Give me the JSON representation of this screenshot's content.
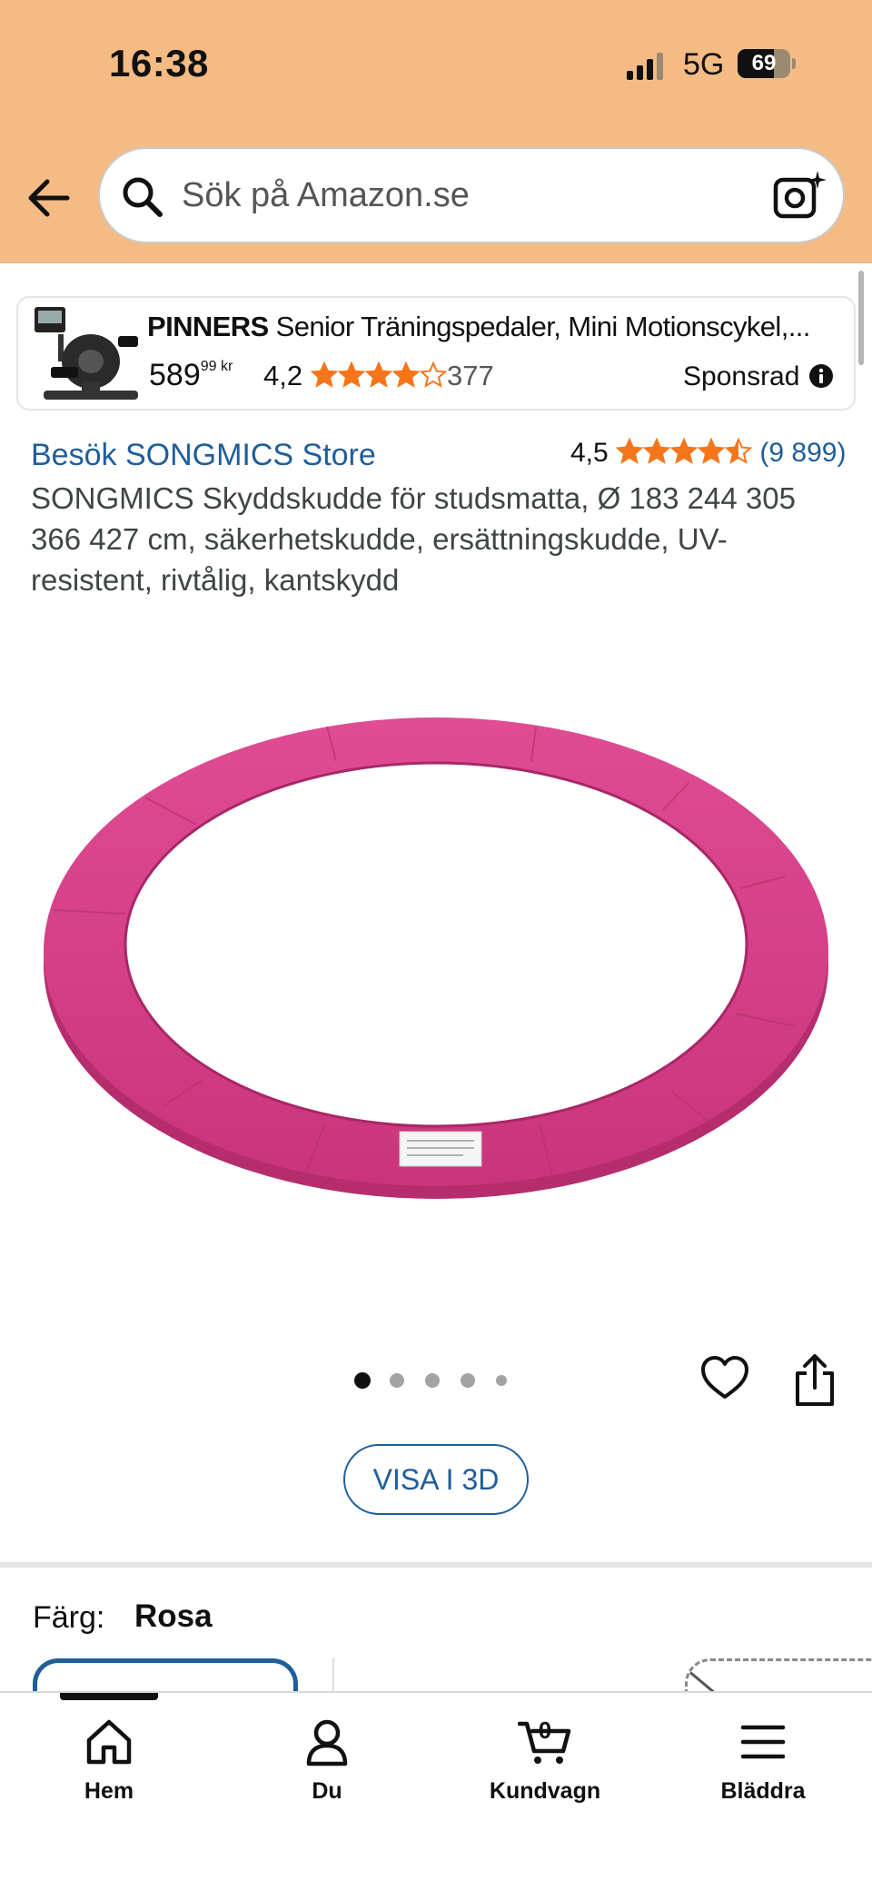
{
  "status_bar": {
    "time": "16:38",
    "network": "5G",
    "battery": "69",
    "battery_level": 0.69
  },
  "header": {
    "search_placeholder": "Sök på Amazon.se",
    "icons": [
      "back-arrow-icon",
      "search-icon",
      "camera-search-icon"
    ]
  },
  "ad": {
    "brand": "PINNERS",
    "title": "Senior Träningspedaler, Mini Motionscykel,...",
    "price_main": "589",
    "price_fraction": "99",
    "price_currency": "kr",
    "rating": "4,2",
    "rating_value": 4.2,
    "review_count": "377",
    "sponsored_label": "Sponsrad"
  },
  "product": {
    "store_link": "Besök SONGMICS Store",
    "rating": "4,5",
    "rating_value": 4.5,
    "review_count": "(9 899)",
    "title": "SONGMICS Skyddskudde för studsmatta, Ø 183 244 305 366 427 cm, säkerhetskudde, ersättningskudde, UV-resistent, rivtålig, kantskydd",
    "image_color": "#d93f8a",
    "image_count": 5,
    "active_image": 1,
    "view_3d_label": "VISA I 3D"
  },
  "variation": {
    "color_label": "Färg:",
    "color_value": "Rosa"
  },
  "bottom_nav": {
    "items": [
      {
        "label": "Hem",
        "icon": "home-icon"
      },
      {
        "label": "Du",
        "icon": "user-icon"
      },
      {
        "label": "Kundvagn",
        "icon": "cart-icon"
      },
      {
        "label": "Bläddra",
        "icon": "menu-icon"
      }
    ],
    "cart_count": "0",
    "active_index": 0
  },
  "colors": {
    "header_bg": "#f4bc84",
    "link": "#1f5e9a",
    "star": "#f5761a"
  }
}
